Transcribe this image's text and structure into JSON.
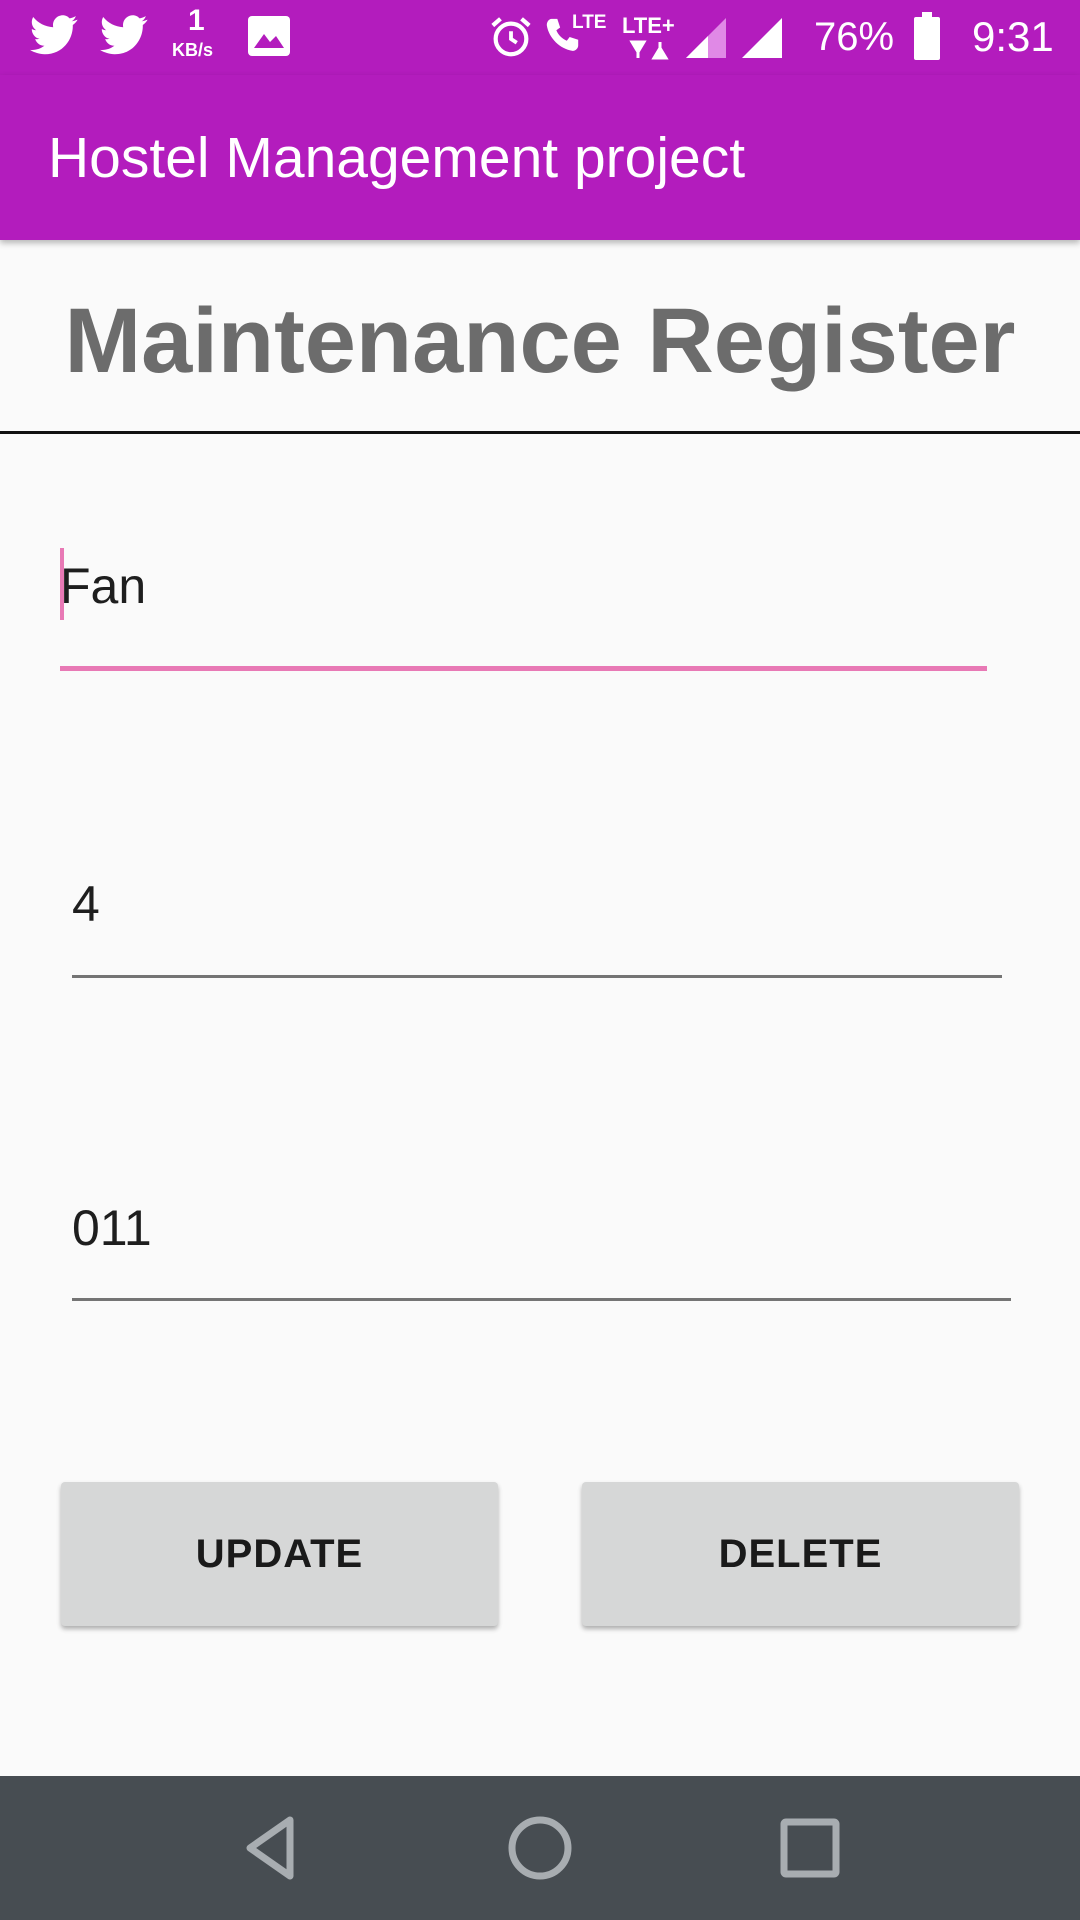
{
  "status_bar": {
    "speed_value": "1",
    "speed_unit": "KB/s",
    "lte_label": "LTE",
    "lte_plus_label": "LTE+",
    "battery": "76%",
    "time": "9:31",
    "icons": [
      "twitter-icon",
      "twitter-icon",
      "image-icon",
      "alarm-icon",
      "volte-call-icon",
      "data-arrows-icon",
      "signal-icon",
      "signal-icon",
      "battery-icon"
    ]
  },
  "app_bar": {
    "title": "Hostel Management project"
  },
  "page": {
    "heading": "Maintenance Register"
  },
  "form": {
    "item_value": "Fan",
    "quantity_value": "4",
    "room_value": "011"
  },
  "buttons": {
    "update_label": "UPDATE",
    "delete_label": "DELETE"
  },
  "nav_bar": {
    "icons": [
      "back-icon",
      "home-icon",
      "recents-icon"
    ]
  },
  "colors": {
    "primary": "#b31cbd",
    "accent": "#e879b5",
    "background": "#fafafa",
    "nav_bar": "#474d52",
    "button": "#d6d7d7"
  }
}
